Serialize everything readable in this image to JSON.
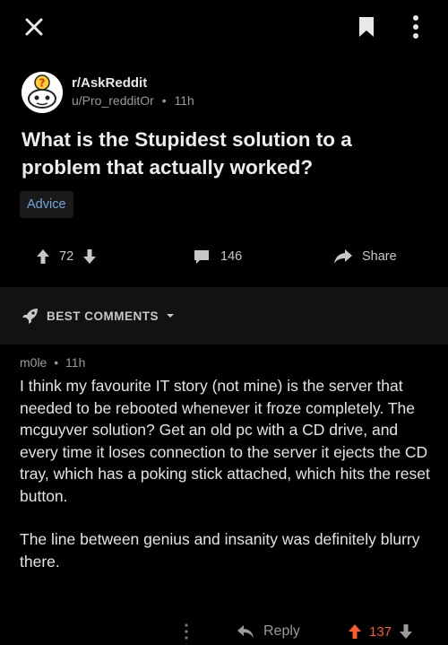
{
  "topbar": {
    "close_icon": "close-icon",
    "bookmark_icon": "bookmark-icon",
    "more_icon": "more-vertical-icon"
  },
  "post": {
    "subreddit": "r/AskReddit",
    "author": "u/Pro_redditOr",
    "separator": "•",
    "age": "11h",
    "title": "What is the Stupidest solution to a problem that actually worked?",
    "flair": "Advice",
    "score": "72",
    "comments": "146",
    "share_label": "Share"
  },
  "sort": {
    "label": "BEST COMMENTS"
  },
  "comment": {
    "author": "m0le",
    "separator": "•",
    "age": "11h",
    "paragraph_1": "I think my favourite IT story (not mine) is the server that needed to be rebooted whenever it froze completely. The mcguyver solution? Get an old pc with a CD drive, and every time it loses connection to the server it ejects the CD tray, which has a poking stick attached, which hits the reset button.",
    "paragraph_2": "The line between genius and insanity was definitely blurry there.",
    "reply_label": "Reply",
    "score": "137"
  },
  "colors": {
    "background": "#000000",
    "flair_text": "#6fa5e0",
    "upvoted": "#ff5a2b"
  }
}
